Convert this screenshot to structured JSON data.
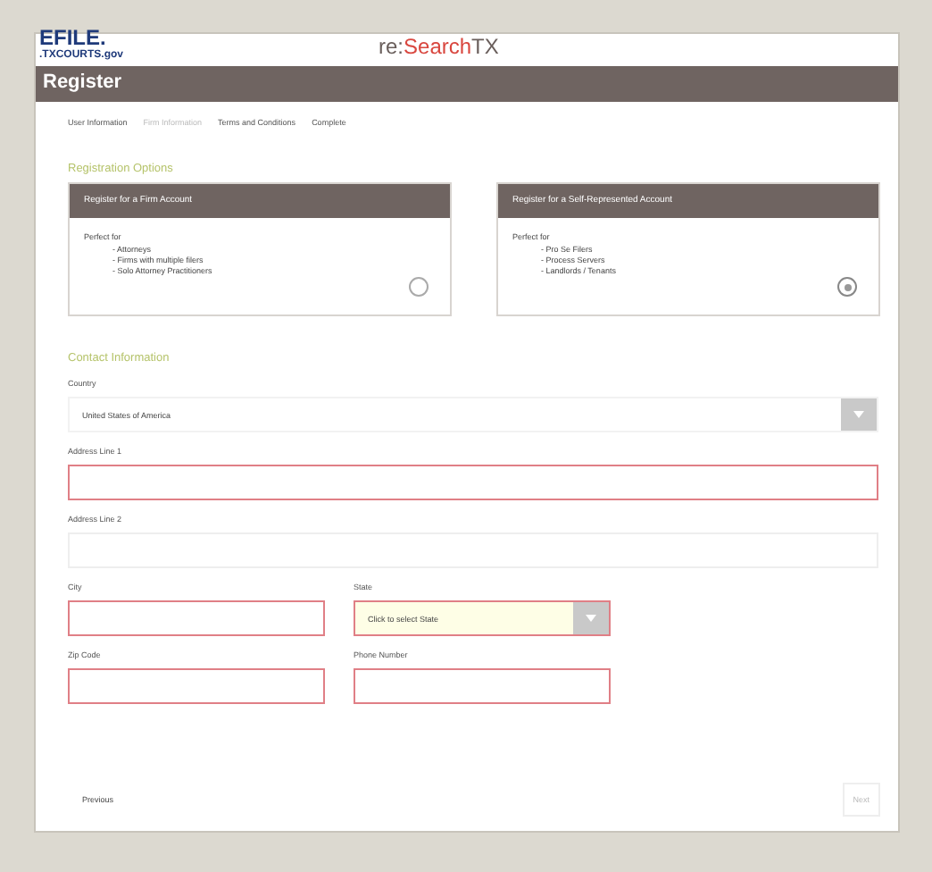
{
  "logo": {
    "main": "EFILE.",
    "sub": ".TXCOURTS.gov"
  },
  "brand": [
    {
      "text": "re:",
      "color": "#6a5f5c"
    },
    {
      "text": "Search",
      "color": "#d9473f"
    },
    {
      "text": "TX",
      "color": "#6a5f5c"
    }
  ],
  "page_title": "Register",
  "steps": [
    {
      "label": "User Information",
      "selected": false
    },
    {
      "label": "Firm Information",
      "selected": true
    },
    {
      "label": "Terms and Conditions",
      "selected": false
    },
    {
      "label": "Complete",
      "selected": false
    }
  ],
  "registration_heading": "Registration Options",
  "options": [
    {
      "title": "Register for a Firm Account",
      "intro": "Perfect for",
      "items": [
        "- Attorneys",
        "- Firms with multiple filers",
        "- Solo Attorney Practitioners"
      ],
      "selected": false
    },
    {
      "title": "Register for a Self-Represented Account",
      "intro": "Perfect for",
      "items": [
        "- Pro Se Filers",
        "- Process Servers",
        "- Landlords / Tenants"
      ],
      "selected": true
    }
  ],
  "contact_heading": "Contact Information",
  "rows": [
    [
      {
        "label": "Country",
        "kind": "select",
        "value": "United States of America",
        "required": false
      }
    ],
    [
      {
        "label": "Address Line 1",
        "kind": "text",
        "required": true
      }
    ],
    [
      {
        "label": "Address Line 2",
        "kind": "text",
        "required": false
      }
    ],
    [
      {
        "label": "City",
        "kind": "text",
        "required": true
      },
      {
        "label": "State",
        "kind": "select",
        "placeholder": "Click to select State",
        "required": true
      }
    ],
    [
      {
        "label": "Zip Code",
        "kind": "text",
        "required": true
      },
      {
        "label": "Phone Number",
        "kind": "text",
        "required": true
      }
    ]
  ],
  "buttons": [
    {
      "label": "Previous",
      "disabled": false
    },
    {
      "label": "Next",
      "disabled": true
    }
  ]
}
